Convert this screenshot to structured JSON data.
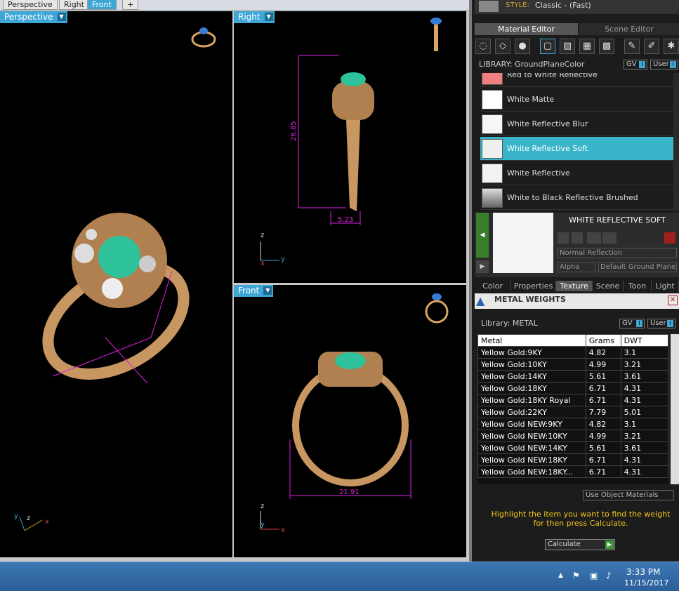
{
  "view_tabs": [
    "Perspective",
    "Right",
    "Front",
    "+"
  ],
  "viewports": {
    "perspective": {
      "label": "Perspective"
    },
    "right": {
      "label": "Right",
      "dims": {
        "height": "26.85",
        "width": "5.23"
      }
    },
    "front": {
      "label": "Front",
      "dims": {
        "width": "21.91"
      }
    }
  },
  "style": {
    "label": "STYLE:",
    "value": "Classic - (Fast)"
  },
  "panel_tabs": {
    "material_editor": "Material Editor",
    "scene_editor": "Scene Editor"
  },
  "library": {
    "label": "LIBRARY: GroundPlaneColor",
    "gv": "GV",
    "user": "User"
  },
  "materials": [
    {
      "name": "Red to White Reflective",
      "color": "#f08080"
    },
    {
      "name": "White Matte",
      "color": "#ffffff"
    },
    {
      "name": "White Reflective Blur",
      "color": "#f6f6f6"
    },
    {
      "name": "White Reflective Soft",
      "color": "#efefef"
    },
    {
      "name": "White Reflective",
      "color": "#f2f2f2"
    },
    {
      "name": "White to Black Reflective Brushed",
      "color": "#9a9a9a"
    }
  ],
  "selected_material": {
    "title": "WHITE REFLECTIVE SOFT",
    "reflection": "Normal Reflection",
    "alpha": "Alpha",
    "ground": "Default Ground Plane"
  },
  "bottom_tabs": [
    "Color",
    "Properties",
    "Texture",
    "Scene",
    "Toon",
    "Light"
  ],
  "metal_weights": {
    "title": "METAL WEIGHTS",
    "library": "Library: METAL",
    "gv": "GV",
    "user": "User",
    "columns": [
      "Metal",
      "Grams",
      "DWT"
    ],
    "rows": [
      [
        "Yellow Gold:9KY",
        "4.82",
        "3.1"
      ],
      [
        "Yellow Gold:10KY",
        "4.99",
        "3.21"
      ],
      [
        "Yellow Gold:14KY",
        "5.61",
        "3.61"
      ],
      [
        "Yellow Gold:18KY",
        "6.71",
        "4.31"
      ],
      [
        "Yellow Gold:18KY Royal",
        "6.71",
        "4.31"
      ],
      [
        "Yellow Gold:22KY",
        "7.79",
        "5.01"
      ],
      [
        "Yellow Gold NEW:9KY",
        "4.82",
        "3.1"
      ],
      [
        "Yellow Gold NEW:10KY",
        "4.99",
        "3.21"
      ],
      [
        "Yellow Gold NEW:14KY",
        "5.61",
        "3.61"
      ],
      [
        "Yellow Gold NEW:18KY",
        "6.71",
        "4.31"
      ],
      [
        "Yellow Gold NEW:18KY...",
        "6.71",
        "4.31"
      ]
    ],
    "use_object_materials": "Use Object Materials",
    "hint": "Highlight the item you want to find the weight for then press Calculate.",
    "calculate": "Calculate"
  },
  "taskbar": {
    "time": "3:33 PM",
    "date": "11/15/2017"
  },
  "colors": {
    "accent": "#3fa7d6",
    "selected": "#3ab4c8",
    "dim": "#e020e0",
    "gold": "#d9a460",
    "hint": "#f5c518"
  }
}
